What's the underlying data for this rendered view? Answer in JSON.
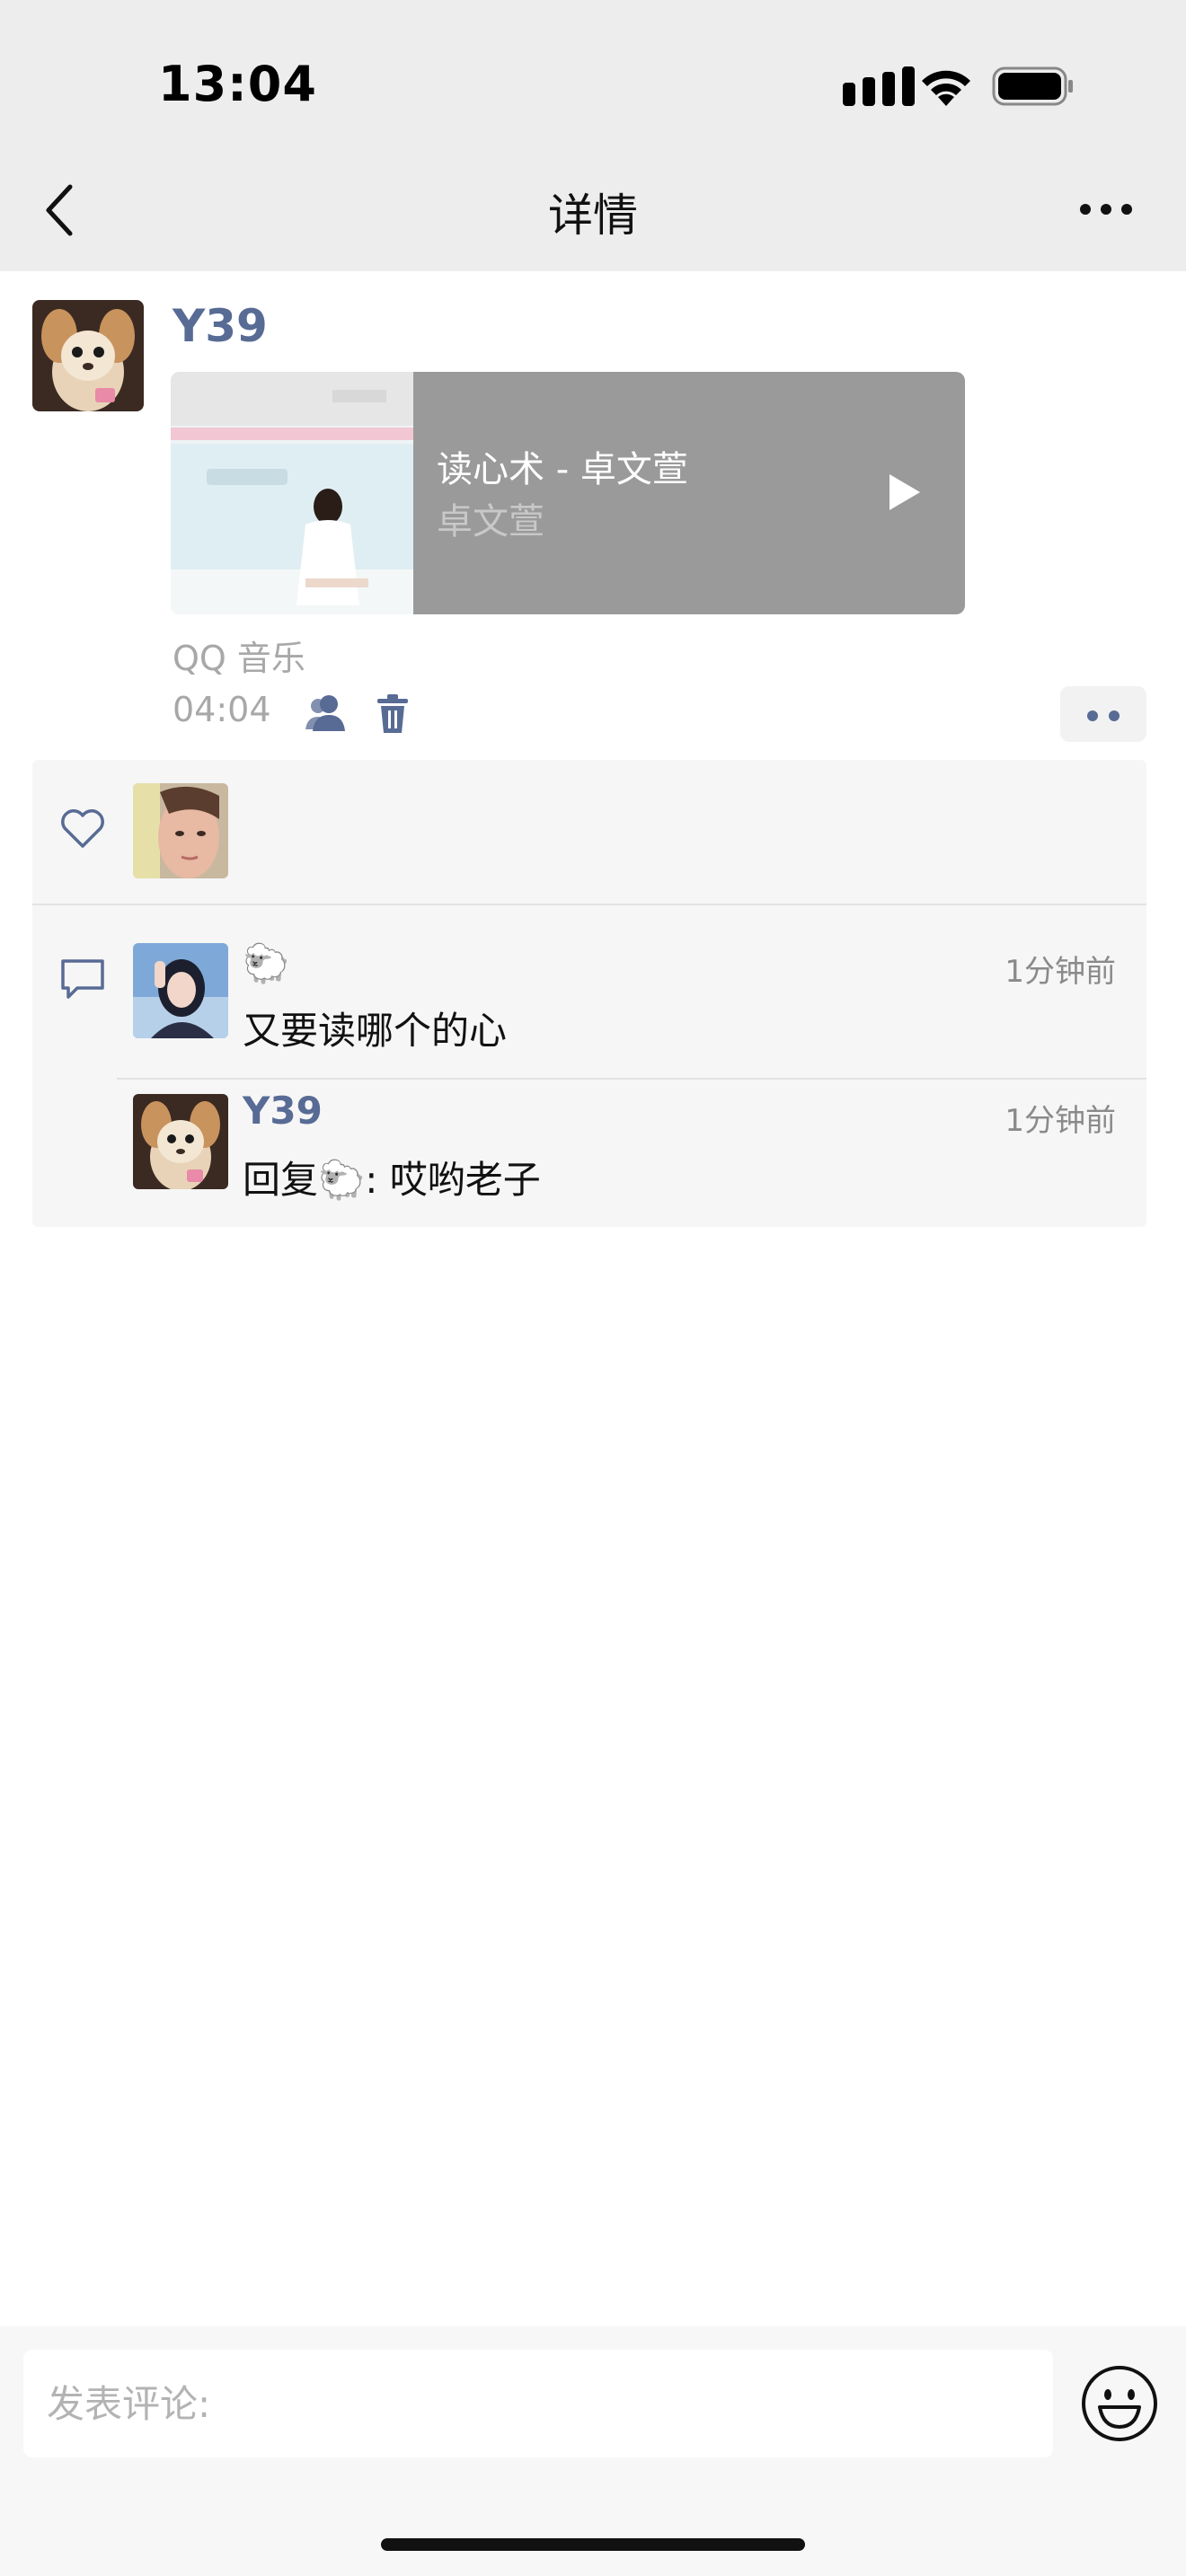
{
  "status_bar": {
    "time": "13:04"
  },
  "nav": {
    "title": "详情"
  },
  "post": {
    "author": "Y39",
    "music": {
      "title": "读心术 - 卓文萱",
      "artist": "卓文萱"
    },
    "source": "QQ 音乐",
    "time": "04:04"
  },
  "comments": [
    {
      "name": "🐑",
      "text": "又要读哪个的心",
      "time": "1分钟前"
    },
    {
      "name": "Y39",
      "text": "回复🐑: 哎哟老子",
      "time": "1分钟前"
    }
  ],
  "input": {
    "placeholder": "发表评论:"
  },
  "colors": {
    "link_blue": "#586b95",
    "nav_bg": "#ededed",
    "panel_bg": "#f6f6f6"
  },
  "icons": [
    "back-icon",
    "more-icon",
    "play-icon",
    "friends-icon",
    "trash-icon",
    "heart-icon",
    "comment-icon",
    "smile-icon"
  ]
}
